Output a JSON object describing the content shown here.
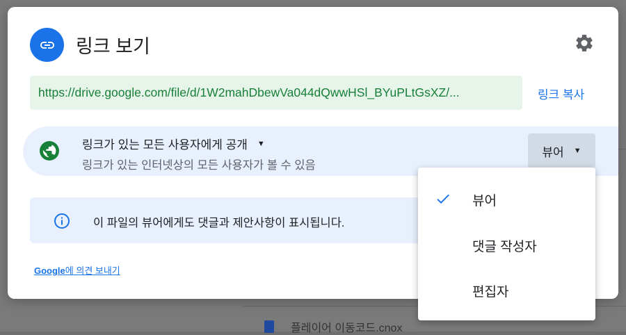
{
  "dialog": {
    "title": "링크 보기",
    "url": "https://drive.google.com/file/d/1W2mahDbewVa044dQwwHSl_BYuPLtGsXZ/...",
    "copy_link_label": "링크 복사",
    "access": {
      "title": "링크가 있는 모든 사용자에게 공개",
      "subtitle": "링크가 있는 인터넷상의 모든 사용자가 볼 수 있음",
      "role": "뷰어"
    },
    "info_text": "이 파일의 뷰어에게도 댓글과 제안사항이 표시됩니다.",
    "feedback": {
      "brand": "Google",
      "text": "에 의견 보내기"
    }
  },
  "role_menu": {
    "items": [
      {
        "label": "뷰어",
        "selected": true
      },
      {
        "label": "댓글 작성자",
        "selected": false
      },
      {
        "label": "편집자",
        "selected": false
      }
    ]
  },
  "background": {
    "bottom_file_name": "플레이어 이동코드.cnox"
  },
  "colors": {
    "accent": "#1a73e8",
    "url_text": "#188038",
    "url_bg": "#e6f4ea",
    "access_bg": "#e8f0fe",
    "globe": "#188038"
  },
  "icons": {
    "header": "link-icon",
    "settings": "gear-icon",
    "access": "globe-icon",
    "info": "info-icon",
    "check": "check-icon"
  }
}
